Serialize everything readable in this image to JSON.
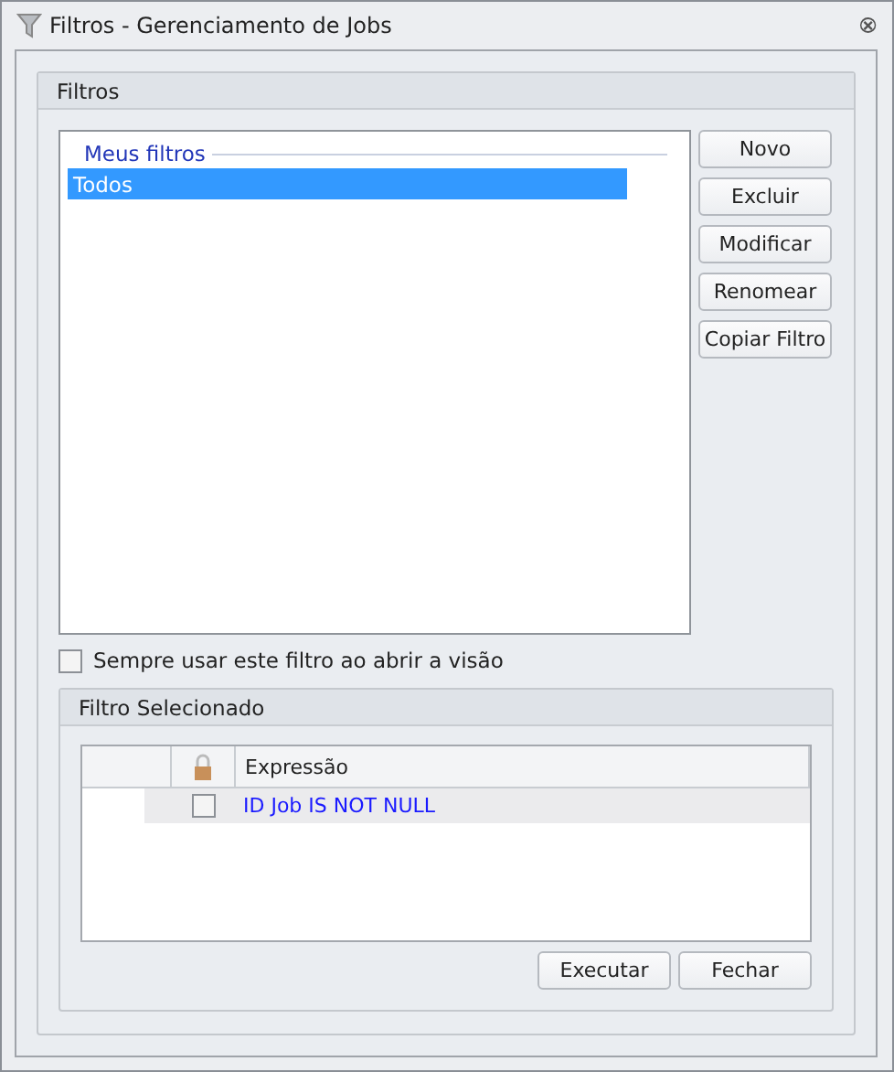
{
  "window": {
    "title": "Filtros - Gerenciamento de Jobs",
    "close": "⮿"
  },
  "filters_group": {
    "title": "Filtros",
    "list_header": "Meus filtros",
    "items": [
      {
        "label": "Todos",
        "selected": true
      }
    ],
    "buttons": [
      "Novo",
      "Excluir",
      "Modificar",
      "Renomear",
      "Copiar Filtro"
    ]
  },
  "always_use": {
    "label": "Sempre usar este filtro ao abrir a visão",
    "checked": false
  },
  "selected_group": {
    "title": "Filtro Selecionado",
    "columns": [
      "Expressão"
    ],
    "rows": [
      {
        "locked": false,
        "expression": "ID Job IS NOT NULL"
      }
    ]
  },
  "footer_buttons": [
    "Executar",
    "Fechar"
  ]
}
